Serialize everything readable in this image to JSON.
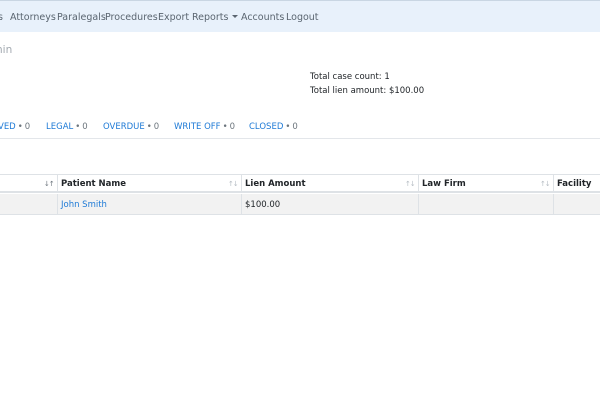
{
  "nav": {
    "items": [
      {
        "label": "s"
      },
      {
        "label": "Attorneys"
      },
      {
        "label": "Paralegals"
      },
      {
        "label": "Procedures"
      },
      {
        "label": "Export"
      },
      {
        "label": "Reports"
      },
      {
        "label": "Accounts"
      },
      {
        "label": "Logout"
      }
    ]
  },
  "page": {
    "admin_text": "nin"
  },
  "summary": {
    "case_count": "Total case count: 1",
    "lien_amount": "Total lien amount: $100.00"
  },
  "status_tabs": [
    {
      "label": "VED",
      "count": "0"
    },
    {
      "label": "LEGAL",
      "count": "0"
    },
    {
      "label": "OVERDUE",
      "count": "0"
    },
    {
      "label": "WRITE OFF",
      "count": "0"
    },
    {
      "label": "CLOSED",
      "count": "0"
    }
  ],
  "status_separator": "•",
  "table": {
    "columns": [
      {
        "label": "",
        "sort_icon": "sort-desc-icon"
      },
      {
        "label": "Patient Name",
        "sort_icon": "sort-icon"
      },
      {
        "label": "Lien Amount",
        "sort_icon": "sort-icon"
      },
      {
        "label": "Law Firm",
        "sort_icon": "sort-icon"
      },
      {
        "label": "Facility",
        "sort_icon": ""
      }
    ],
    "rows": [
      {
        "patient_name": "John Smith",
        "lien_amount": "$100.00",
        "law_firm": "",
        "facility": ""
      }
    ]
  },
  "colors": {
    "navbar_bg": "#e8f1fb",
    "link": "#1e7ad6",
    "row_stripe": "#f2f2f2"
  }
}
